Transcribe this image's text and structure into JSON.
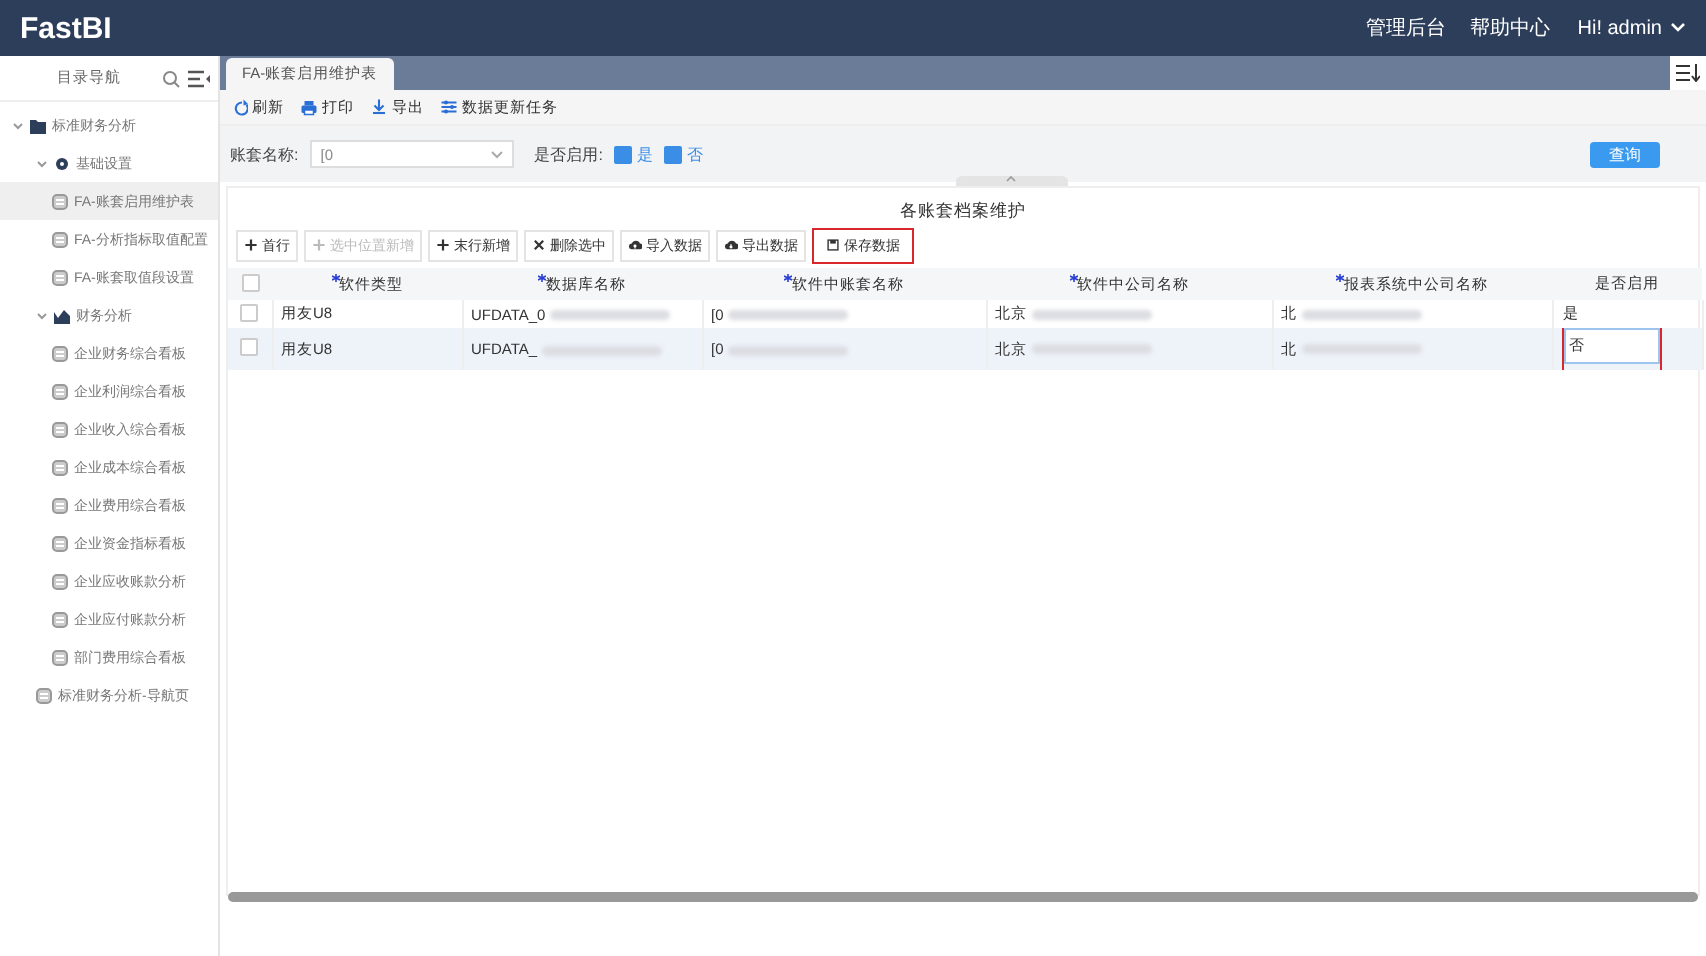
{
  "header": {
    "logo": "FastBI",
    "links": [
      "管理后台",
      "帮助中心"
    ],
    "user": "Hi!  admin"
  },
  "sidebar": {
    "title": "目录导航",
    "tree": [
      {
        "label": "标准财务分析",
        "kind": "folder",
        "expanded": true,
        "selected": false,
        "children": [
          {
            "label": "基础设置",
            "kind": "gear",
            "expanded": true,
            "selected": false,
            "children": [
              {
                "label": "FA-账套启用维护表",
                "kind": "page",
                "selected": true
              },
              {
                "label": "FA-分析指标取值配置",
                "kind": "page",
                "selected": false
              },
              {
                "label": "FA-账套取值段设置",
                "kind": "page",
                "selected": false
              }
            ]
          },
          {
            "label": "财务分析",
            "kind": "chart",
            "expanded": true,
            "selected": false,
            "children": [
              {
                "label": "企业财务综合看板",
                "kind": "page",
                "selected": false
              },
              {
                "label": "企业利润综合看板",
                "kind": "page",
                "selected": false
              },
              {
                "label": "企业收入综合看板",
                "kind": "page",
                "selected": false
              },
              {
                "label": "企业成本综合看板",
                "kind": "page",
                "selected": false
              },
              {
                "label": "企业费用综合看板",
                "kind": "page",
                "selected": false
              },
              {
                "label": "企业资金指标看板",
                "kind": "page",
                "selected": false
              },
              {
                "label": "企业应收账款分析",
                "kind": "page",
                "selected": false
              },
              {
                "label": "企业应付账款分析",
                "kind": "page",
                "selected": false
              },
              {
                "label": "部门费用综合看板",
                "kind": "page",
                "selected": false
              }
            ]
          }
        ]
      },
      {
        "label": "标准财务分析-导航页",
        "kind": "page",
        "selected": false
      }
    ]
  },
  "tabs": [
    {
      "label": "FA-账套启用维护表",
      "selected": true
    }
  ],
  "toolbar": [
    {
      "label": "刷新",
      "kind": "refresh"
    },
    {
      "label": "打印",
      "kind": "print"
    },
    {
      "label": "导出",
      "kind": "export"
    },
    {
      "label": "数据更新任务",
      "kind": "task"
    }
  ],
  "filter": {
    "account_label": "账套名称:",
    "account_value": "[0",
    "enabled_label": "是否启用:",
    "options": [
      {
        "label": "是",
        "checked": true
      },
      {
        "label": "否",
        "checked": true
      }
    ],
    "query_button": "查询"
  },
  "table_panel": {
    "title": "各账套档案维护",
    "actions": [
      {
        "label": "首行",
        "kind": "plus",
        "disabled": false,
        "highlighted": false
      },
      {
        "label": "选中位置新增",
        "kind": "plus",
        "disabled": true,
        "highlighted": false
      },
      {
        "label": "末行新增",
        "kind": "plus",
        "disabled": false,
        "highlighted": false
      },
      {
        "label": "删除选中",
        "kind": "delete",
        "disabled": false,
        "highlighted": false
      },
      {
        "label": "导入数据",
        "kind": "cloud-up",
        "disabled": false,
        "highlighted": false
      },
      {
        "label": "导出数据",
        "kind": "cloud-down",
        "disabled": false,
        "highlighted": false
      },
      {
        "label": "保存数据",
        "kind": "save",
        "disabled": false,
        "highlighted": true
      }
    ],
    "all_checked": false,
    "columns": [
      {
        "label": "软件类型",
        "required": true
      },
      {
        "label": "数据库名称",
        "required": true
      },
      {
        "label": "软件中账套名称",
        "required": true
      },
      {
        "label": "软件中公司名称",
        "required": true
      },
      {
        "label": "报表系统中公司名称",
        "required": true
      },
      {
        "label": "是否启用",
        "required": false
      }
    ],
    "rows": [
      {
        "selected": false,
        "checked": false,
        "cells": [
          {
            "text": "用友U8",
            "blurred": false
          },
          {
            "text": "UFDATA_0",
            "blurred": true
          },
          {
            "text": "[0",
            "blurred": true
          },
          {
            "text": "北京",
            "blurred": true
          },
          {
            "text": "北",
            "blurred": true
          },
          {
            "text": "是",
            "blurred": false
          }
        ],
        "editing": false,
        "highlighted": false
      },
      {
        "selected": true,
        "checked": false,
        "cells": [
          {
            "text": "用友U8",
            "blurred": false
          },
          {
            "text": "UFDATA_",
            "blurred": true
          },
          {
            "text": "[0",
            "blurred": true
          },
          {
            "text": "北京",
            "blurred": true
          },
          {
            "text": "北",
            "blurred": true
          },
          {
            "text": "否",
            "blurred": false
          }
        ],
        "editing": true,
        "highlighted": true
      }
    ]
  }
}
